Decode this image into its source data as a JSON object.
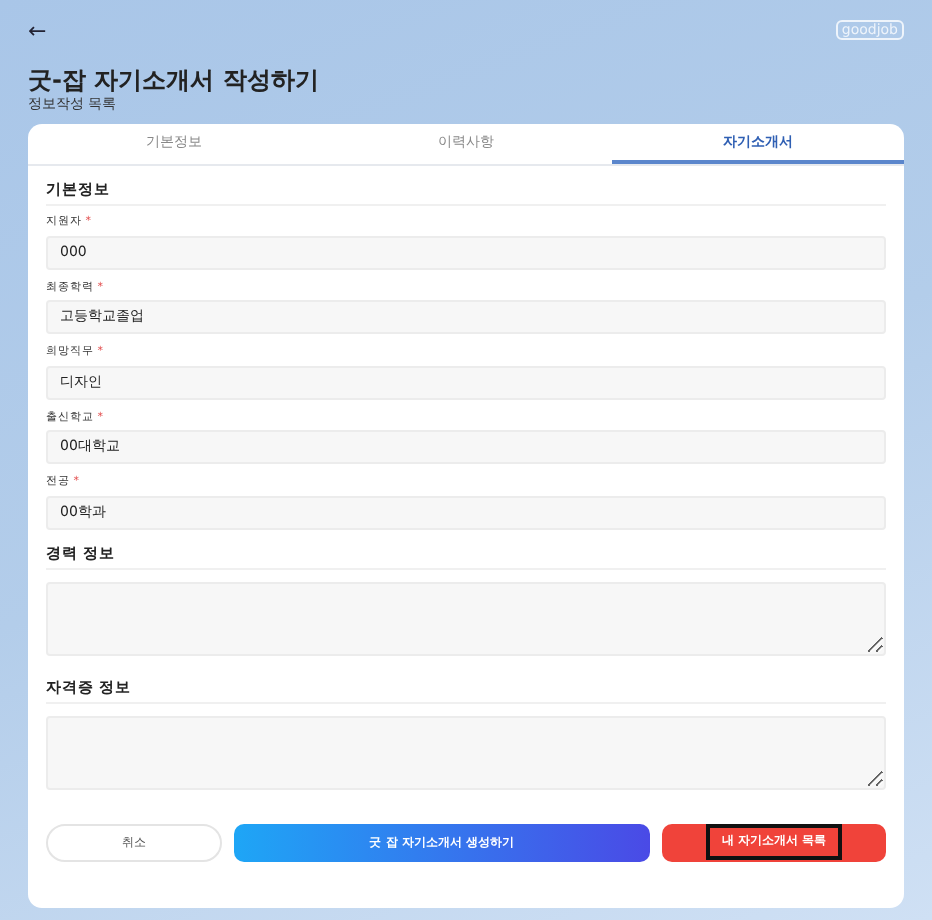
{
  "header": {
    "back": "←",
    "logo": "goodjob",
    "title": "굿-잡 자기소개서 작성하기",
    "subtitle": "정보작성 목록"
  },
  "tabs": [
    {
      "label": "기본정보",
      "selected": false
    },
    {
      "label": "이력사항",
      "selected": false
    },
    {
      "label": "자기소개서",
      "selected": true
    }
  ],
  "basic_section": {
    "heading": "기본정보",
    "fields": [
      {
        "label": "지원자",
        "required_mark": "*",
        "value": "000"
      },
      {
        "label": "최종학력",
        "required_mark": "*",
        "value": "고등학교졸업"
      },
      {
        "label": "희망직무",
        "required_mark": "*",
        "value": "디자인"
      },
      {
        "label": "출신학교",
        "required_mark": "*",
        "value": "00대학교"
      },
      {
        "label": "전공",
        "required_mark": "*",
        "value": "00학과"
      }
    ]
  },
  "text_sections": [
    {
      "heading": "경력 정보"
    },
    {
      "heading": "자격증 정보"
    }
  ],
  "buttons": [
    {
      "kind": "outline",
      "label": "취소",
      "highlighted": false
    },
    {
      "kind": "gradient",
      "label": "굿 잡 자기소개서 생성하기",
      "highlighted": false
    },
    {
      "kind": "danger",
      "label": "내 자기소개서 목록",
      "highlighted": true
    }
  ]
}
